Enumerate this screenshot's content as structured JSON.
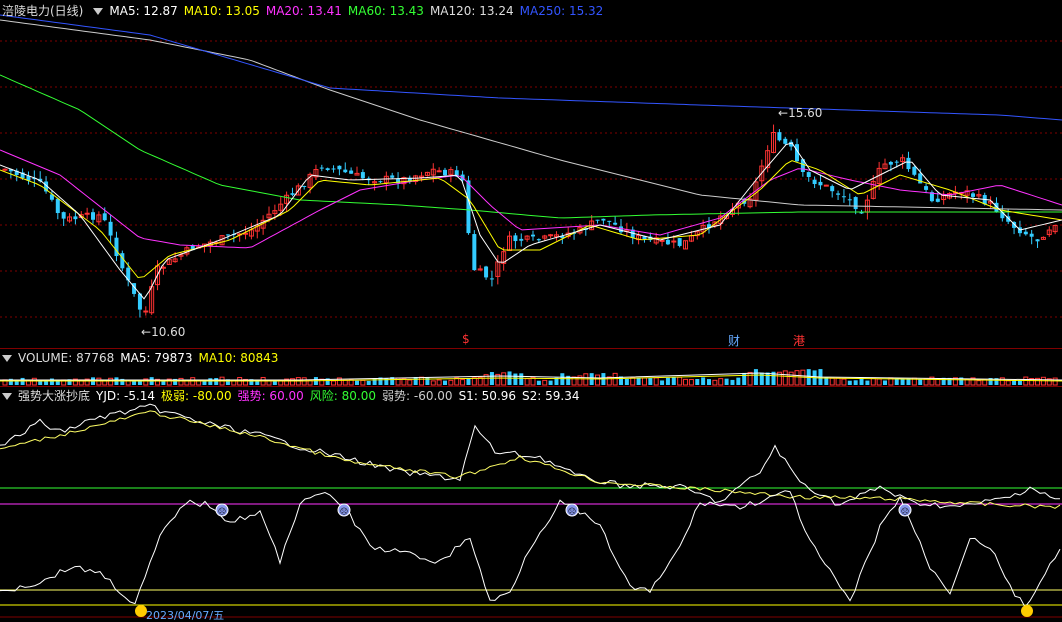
{
  "price": {
    "stock": "涪陵电力(日线)",
    "ma": [
      {
        "label": "MA5: 12.87",
        "color": "#ffffff"
      },
      {
        "label": "MA10: 13.05",
        "color": "#ffff00"
      },
      {
        "label": "MA20: 13.41",
        "color": "#ff33ff"
      },
      {
        "label": "MA60: 13.43",
        "color": "#33ff33"
      },
      {
        "label": "MA120: 13.24",
        "color": "#dddddd"
      },
      {
        "label": "MA250: 15.32",
        "color": "#3355ff"
      }
    ],
    "high_label": "15.60",
    "low_label": "10.60",
    "markers": [
      {
        "text": "$",
        "color": "#ff3333"
      },
      {
        "text": "财",
        "color": "#66aaff"
      },
      {
        "text": "港",
        "color": "#ff3333"
      }
    ]
  },
  "volume": {
    "label": "VOLUME: 87768",
    "ma5": "MA5: 79873",
    "ma10": "MA10: 80843"
  },
  "indicator": {
    "name": "强势大涨抄底",
    "items": [
      {
        "label": "YJD: -5.14",
        "color": "#ffffff"
      },
      {
        "label": "极弱: -80.00",
        "color": "#ffff00"
      },
      {
        "label": "强势: 60.00",
        "color": "#ff33ff"
      },
      {
        "label": "风险: 80.00",
        "color": "#33ff33"
      },
      {
        "label": "弱势: -60.00",
        "color": "#cccccc"
      },
      {
        "label": "S1: 50.96",
        "color": "#ffffff"
      },
      {
        "label": "S2: 59.34",
        "color": "#ffffff"
      }
    ],
    "bottom_date": "2023/04/07/五"
  },
  "colors": {
    "up": "#ff3333",
    "down": "#33ccff",
    "grid": "#800000"
  }
}
